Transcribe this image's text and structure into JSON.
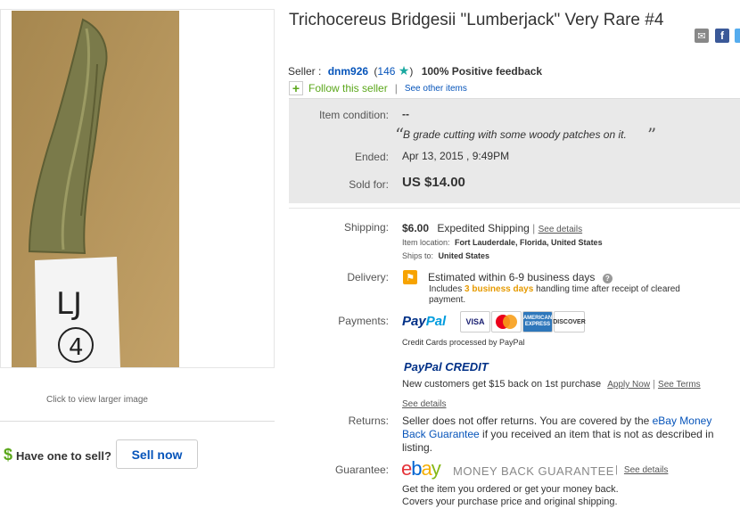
{
  "listing": {
    "title": "Trichocereus Bridgesii \"Lumberjack\" Very Rare #4",
    "photo_label": "LJ",
    "photo_number": "4",
    "click_larger": "Click to view larger image"
  },
  "sell": {
    "dollar": "$",
    "prompt": "Have one to sell?",
    "button": "Sell now"
  },
  "share": {
    "email_icon": "email-icon",
    "facebook_icon": "facebook-icon",
    "twitter_icon": "twitter-icon"
  },
  "seller": {
    "label": "Seller :",
    "name": "dnm926",
    "feedback_open": "(",
    "feedback_score": "146",
    "feedback_close": ")",
    "positive": "100% Positive feedback",
    "follow": "Follow this seller",
    "divider": "|",
    "other_items": "See other items"
  },
  "status": {
    "condition_label": "Item condition:",
    "condition_value": "--",
    "quote_open": "“",
    "quote": "B grade cutting with some woody patches on it.",
    "quote_close": "”",
    "ended_label": "Ended:",
    "ended_value": "Apr 13, 2015 , 9:49PM",
    "sold_label": "Sold for:",
    "sold_value": "US $14.00"
  },
  "shipping": {
    "label": "Shipping:",
    "cost": "$6.00",
    "method": "Expedited Shipping",
    "divider": "|",
    "details": "See details",
    "location_label": "Item location:",
    "location": "Fort Lauderdale, Florida, United States",
    "ships_label": "Ships to:",
    "ships_to": "United States"
  },
  "delivery": {
    "label": "Delivery:",
    "estimate": "Estimated within 6-9 business days",
    "includes": "Includes",
    "days": "3 business days",
    "handling": "handling time after receipt of cleared",
    "payment": "payment."
  },
  "payments": {
    "label": "Payments:",
    "paypal_1": "Pay",
    "paypal_2": "Pal",
    "cards": [
      "VISA",
      "MasterCard",
      "AMERICAN EXPRESS",
      "DISCOVER"
    ],
    "processed": "Credit Cards processed by PayPal",
    "credit_1": "PayPal",
    "credit_2": "CREDIT",
    "credit_text": "New customers get $15 back on 1st purchase",
    "apply": "Apply Now",
    "divider": "|",
    "terms": "See Terms",
    "details": "See details"
  },
  "returns": {
    "label": "Returns:",
    "line1_a": "Seller does not offer returns. You are covered by the ",
    "line1_link": "eBay Money",
    "line2_link": "Back Guarantee",
    "line2_b": " if you received an item that is not as described in",
    "line3": "listing."
  },
  "guarantee": {
    "label": "Guarantee:",
    "ebay_e": "e",
    "ebay_b": "b",
    "ebay_a": "a",
    "ebay_y": "y",
    "mbg": "MONEY BACK GUARANTEE",
    "divider": "|",
    "details": "See details",
    "line1": "Get the item you ordered or get your money back.",
    "line2": "Covers your purchase price and original shipping."
  },
  "colors": {
    "link": "#0654ba",
    "green": "#5ba71b",
    "status_bg": "#e9e9e9",
    "orange": "#f7a300"
  }
}
